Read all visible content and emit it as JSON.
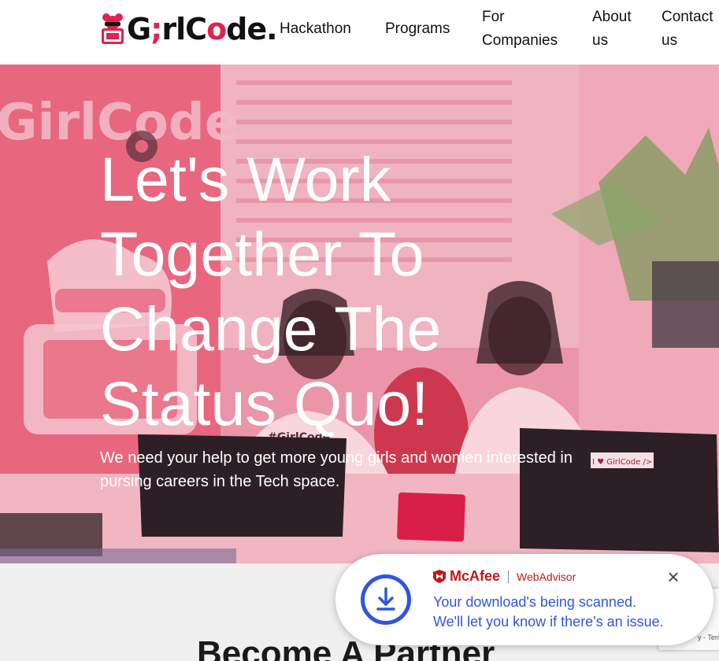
{
  "logo": {
    "prefix": "G",
    "i": ";",
    "mid": "rlC",
    "o": "o",
    "suffix": "de."
  },
  "nav": {
    "hackathon": "Hackathon",
    "programs": "Programs",
    "companies_line1": "For",
    "companies_line2": "Companies",
    "about_line1": "About",
    "about_line2": "us",
    "contact_line1": "Contact",
    "contact_line2": "us"
  },
  "hero": {
    "title": "Let's Work Together To Change The Status Quo!",
    "subtitle": "We need your help to get more young girls and women interested in pursing careers in the Tech space.",
    "banner_text": "GirlCode",
    "shirt_text": "#GirlCode",
    "sticker_text": "I ♥ GirlCode />"
  },
  "partner": {
    "title": "Become A Partner"
  },
  "toast": {
    "brand": "McAfee",
    "product": "WebAdvisor",
    "line1": "Your download's being scanned.",
    "line2": "We'll let you know if there's an issue.",
    "close": "×"
  },
  "recaptcha": {
    "terms": "y - Terms"
  },
  "colors": {
    "brand_pink": "#e0234e",
    "hero_overlay": "#e98ca0",
    "toast_blue": "#2f56e0",
    "mcafee_red": "#c01818"
  }
}
